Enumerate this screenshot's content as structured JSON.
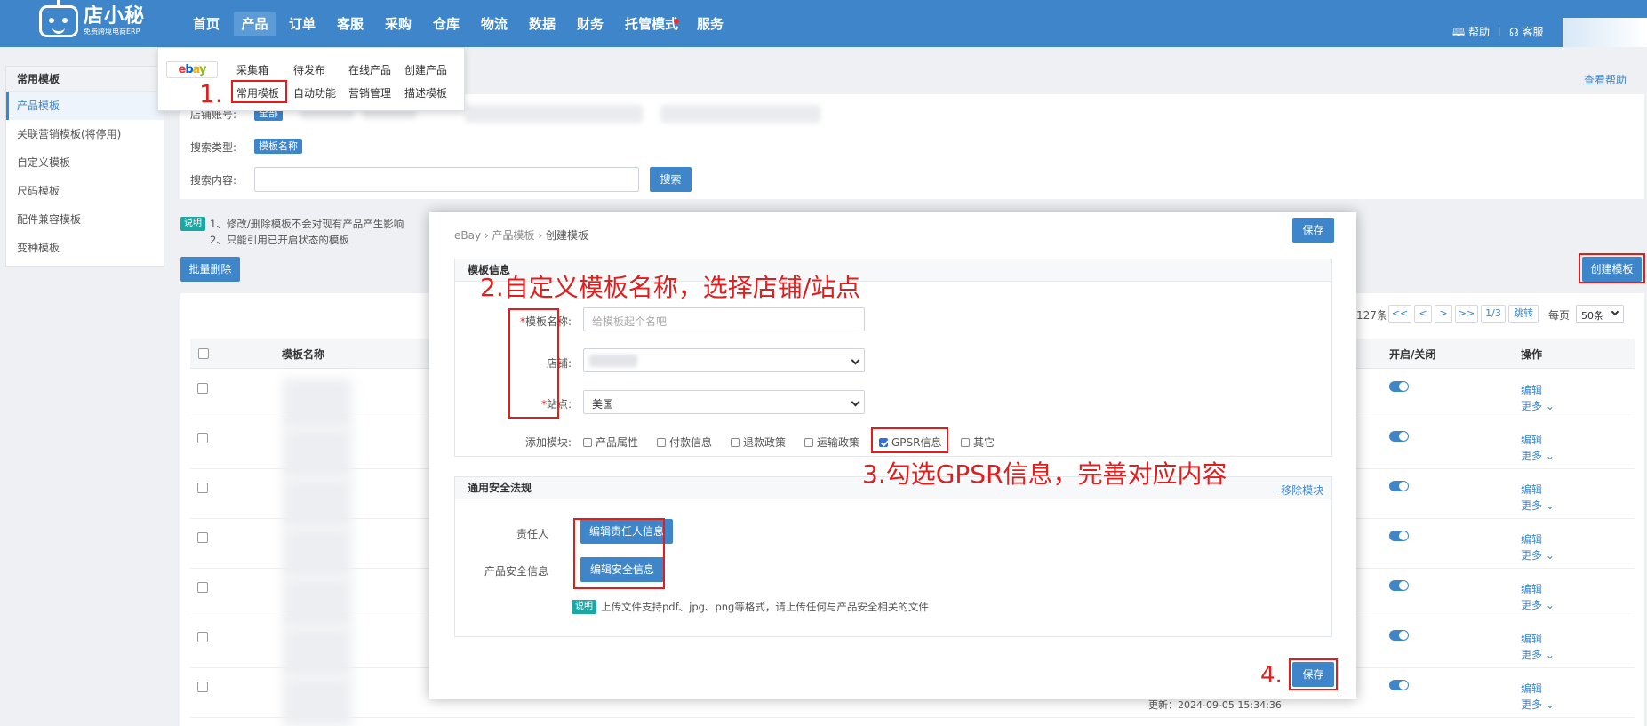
{
  "app": {
    "logo_name": "店小秘",
    "logo_sub": "免费跨境电商ERP"
  },
  "nav": {
    "items": [
      "首页",
      "产品",
      "订单",
      "客服",
      "采购",
      "仓库",
      "物流",
      "数据",
      "财务",
      "托管模式",
      "服务"
    ],
    "help": "帮助",
    "service": "客服",
    "active": "产品"
  },
  "dropdown": {
    "platform": "ebay",
    "row1": [
      "采集箱",
      "待发布",
      "在线产品",
      "创建产品"
    ],
    "row2": [
      "常用模板",
      "自动功能",
      "营销管理",
      "描述模板"
    ]
  },
  "sidebar": {
    "header": "常用模板",
    "items": [
      "产品模板",
      "关联营销模板(将停用)",
      "自定义模板",
      "尺码模板",
      "配件兼容模板",
      "变种模板"
    ]
  },
  "search": {
    "shop_label": "店铺账号:",
    "shop_tag": "全部",
    "type_label": "搜索类型:",
    "type_tag": "模板名称",
    "content_label": "搜索内容:",
    "search_button": "搜索"
  },
  "help_link": "查看帮助",
  "notes": {
    "tag": "说明",
    "line1": "1、修改/删除模板不会对现有产品产生影响",
    "line2": "2、只能引用已开启状态的模板"
  },
  "toolbar": {
    "batch_delete": "批量删除",
    "create_template": "创建模板"
  },
  "pagination": {
    "total": "127条",
    "first": "<<",
    "prev": "<",
    "next": ">",
    "last": ">>",
    "page": "1/3",
    "jump": "跳转",
    "per_page_label": "每页",
    "per_page": "50条"
  },
  "table": {
    "col_name": "模板名称",
    "col_toggle": "开启/关闭",
    "col_action": "操作",
    "edit": "编辑",
    "more": "更多",
    "last_updated": "更新：2024-09-05 15:34:36"
  },
  "modal": {
    "breadcrumb": [
      "eBay",
      "产品模板",
      "创建模板"
    ],
    "save": "保存",
    "info_title": "模板信息",
    "name_label": "模板名称:",
    "name_placeholder": "给模板起个名吧",
    "shop_label": "店铺:",
    "site_label": "站点:",
    "site_value": "美国",
    "modules_label": "添加模块:",
    "modules": [
      {
        "label": "产品属性",
        "checked": false
      },
      {
        "label": "付款信息",
        "checked": false
      },
      {
        "label": "退款政策",
        "checked": false
      },
      {
        "label": "运输政策",
        "checked": false
      },
      {
        "label": "GPSR信息",
        "checked": true
      },
      {
        "label": "其它",
        "checked": false
      }
    ],
    "safety_title": "通用安全法规",
    "remove_module": "- 移除模块",
    "responsible_label": "责任人",
    "responsible_button": "编辑责任人信息",
    "safety_label": "产品安全信息",
    "safety_button": "编辑安全信息",
    "note_tag": "说明",
    "note_text": "上传文件支持pdf、jpg、png等格式，请上传任何与产品安全相关的文件"
  },
  "annotations": {
    "a1": "1.",
    "a2": "2.自定义模板名称，选择店铺/站点",
    "a3": "3.勾选GPSR信息，完善对应内容",
    "a4": "4."
  },
  "colors": {
    "primary": "#3e86c9",
    "annotation_red": "#e01e1e",
    "note_teal": "#1aa8a5"
  }
}
